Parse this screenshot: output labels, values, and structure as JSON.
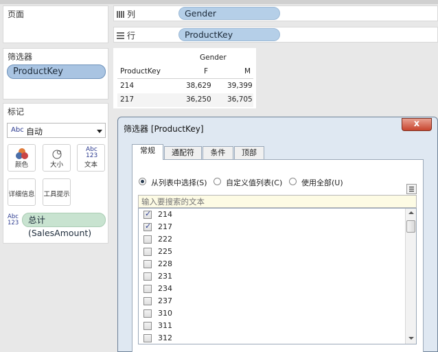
{
  "left": {
    "pages_title": "页面",
    "filters_title": "筛选器",
    "filter_pill": "ProductKey",
    "marks_title": "标记",
    "mark_type": "自动",
    "mark_type_abc": "Abc",
    "buttons": {
      "color": "颜色",
      "size": "大小",
      "text": "文本",
      "detail": "详细信息",
      "tooltip": "工具提示"
    },
    "text_icon_abc": "Abc",
    "text_icon_123": "123",
    "measure_pill": "总计(SalesAmount)"
  },
  "shelves": {
    "columns_label": "列",
    "columns_pill": "Gender",
    "rows_label": "行",
    "rows_pill": "ProductKey"
  },
  "table": {
    "column_header": "Gender",
    "row_header": "ProductKey",
    "col1": "F",
    "col2": "M",
    "rows": [
      {
        "key": "214",
        "f": "38,629",
        "m": "39,399"
      },
      {
        "key": "217",
        "f": "36,250",
        "m": "36,705"
      }
    ]
  },
  "dialog": {
    "title": "筛选器 [ProductKey]",
    "close": "x",
    "tabs": [
      "常规",
      "通配符",
      "条件",
      "顶部"
    ],
    "radio_list": "从列表中选择(S)",
    "radio_custom": "自定义值列表(C)",
    "radio_all": "使用全部(U)",
    "search_placeholder": "输入要搜索的文本",
    "items": [
      {
        "label": "214",
        "checked": true
      },
      {
        "label": "217",
        "checked": true
      },
      {
        "label": "222",
        "checked": false
      },
      {
        "label": "225",
        "checked": false
      },
      {
        "label": "228",
        "checked": false
      },
      {
        "label": "231",
        "checked": false
      },
      {
        "label": "234",
        "checked": false
      },
      {
        "label": "237",
        "checked": false
      },
      {
        "label": "310",
        "checked": false
      },
      {
        "label": "311",
        "checked": false
      },
      {
        "label": "312",
        "checked": false
      }
    ]
  }
}
